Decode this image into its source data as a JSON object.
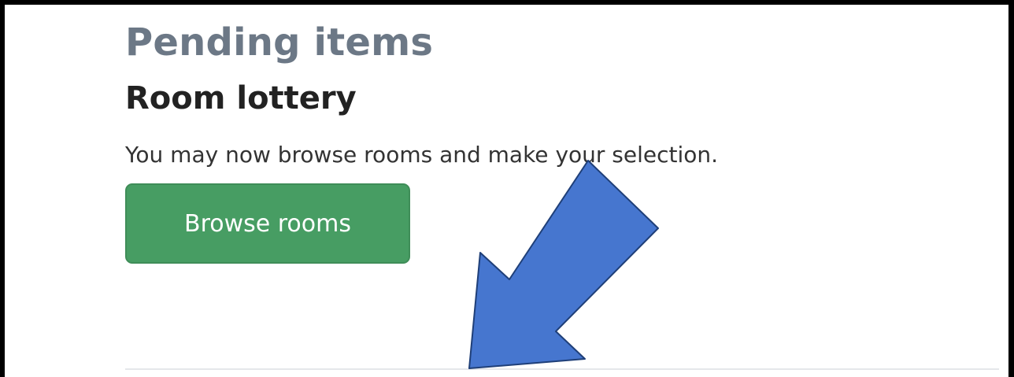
{
  "pending": {
    "heading": "Pending items"
  },
  "room_lottery": {
    "title": "Room lottery",
    "description": "You may now browse rooms and make your selection.",
    "button_label": "Browse rooms"
  },
  "annotation": {
    "arrow_color": "#4676cf",
    "arrow_outline_color": "#1f3f78"
  }
}
